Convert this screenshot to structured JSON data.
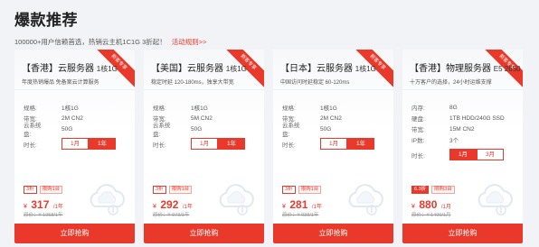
{
  "header": {
    "title": "爆款推荐",
    "subtitle": "100000+用户信赖首选，热销云主机1C1G 3折起！",
    "link": "活动规则>>"
  },
  "cards": [
    {
      "ribbon": "新客专享",
      "title": "【香港】云服务器",
      "spec": "1核1G",
      "desc": "年度热销爆品 免备案云计算服务",
      "specs": [
        {
          "label": "规格:",
          "value": "1核1G"
        },
        {
          "label": "带宽:",
          "value": "2M CN2"
        },
        {
          "label": "云系统盘:",
          "value": "50G"
        }
      ],
      "duration_label": "时长:",
      "durations": [
        "1月",
        "1年"
      ],
      "active_duration": 1,
      "discount": "3折",
      "sub_badge": "限购1台",
      "currency": "¥",
      "price": "317",
      "unit": "/1年",
      "original": "原价：¥ 1058/1年"
    },
    {
      "ribbon": "新客专享",
      "title": "【美国】云服务器",
      "spec": "1核1G",
      "desc": "稳定时延 120-180ms，独享大带宽",
      "specs": [
        {
          "label": "规格:",
          "value": "1核1G"
        },
        {
          "label": "带宽:",
          "value": "5M CN2"
        },
        {
          "label": "云系统盘:",
          "value": "50G"
        }
      ],
      "duration_label": "时长:",
      "durations": [
        "1月",
        "1年"
      ],
      "active_duration": 1,
      "discount": "3折",
      "sub_badge": "限购1台",
      "currency": "¥",
      "price": "292",
      "unit": "/1年",
      "original": "原价：¥ 973/1年"
    },
    {
      "ribbon": "新客专享",
      "title": "【日本】云服务器",
      "spec": "1核1G",
      "desc": "中国访问时延稳定 60-120ms",
      "specs": [
        {
          "label": "规格:",
          "value": "1核1G"
        },
        {
          "label": "带宽:",
          "value": "2M CN2"
        },
        {
          "label": "云系统盘:",
          "value": "50G"
        }
      ],
      "duration_label": "时长:",
      "durations": [
        "1月",
        "1年"
      ],
      "active_duration": 1,
      "discount": "3折",
      "sub_badge": "限购1台",
      "currency": "¥",
      "price": "281",
      "unit": "/1年",
      "original": "原价：¥ 938/1年"
    },
    {
      "ribbon": "新客专享",
      "title": "【香港】物理服务器",
      "spec": "E5 2650",
      "desc": "十万客户的选择，24小时运维支撑",
      "specs": [
        {
          "label": "内存:",
          "value": "8G"
        },
        {
          "label": "硬盘:",
          "value": "1TB HDD/240G SSD"
        },
        {
          "label": "带宽:",
          "value": "15M CN2"
        },
        {
          "label": "IP数:",
          "value": "3个"
        }
      ],
      "duration_label": "时长:",
      "durations": [
        "1月",
        "3月"
      ],
      "active_duration": 0,
      "discount": "6.3折",
      "sub_badge": "限购3台",
      "currency": "¥",
      "price": "880",
      "unit": "/1月",
      "original": "原价：¥ 1400/1月"
    }
  ],
  "buy_label": "立即抢购",
  "colors": {
    "accent": "#e8392b",
    "background": "#f2f3f7"
  }
}
